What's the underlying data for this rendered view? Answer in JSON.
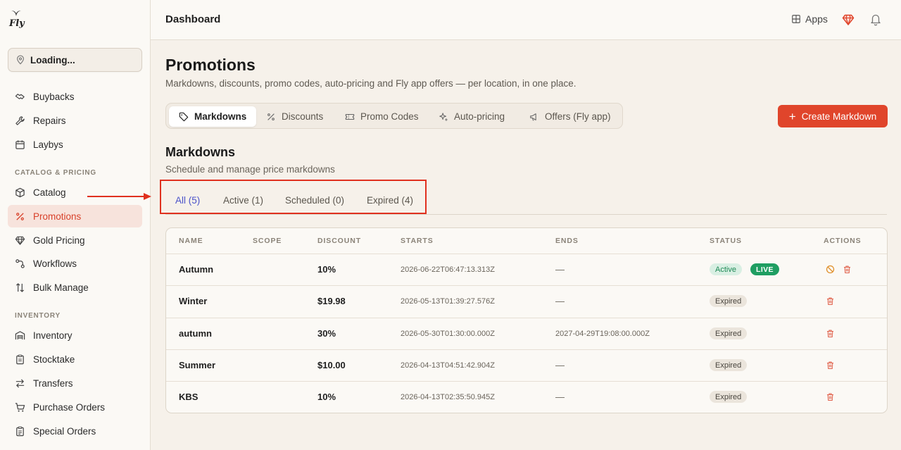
{
  "app": {
    "logo_text": "Fly"
  },
  "location": {
    "value": "Loading..."
  },
  "sidebar": {
    "top_items": [
      {
        "label": "Buybacks"
      },
      {
        "label": "Repairs"
      },
      {
        "label": "Laybys"
      }
    ],
    "sections": [
      {
        "title": "CATALOG & PRICING",
        "items": [
          {
            "label": "Catalog"
          },
          {
            "label": "Promotions"
          },
          {
            "label": "Gold Pricing"
          },
          {
            "label": "Workflows"
          },
          {
            "label": "Bulk Manage"
          }
        ]
      },
      {
        "title": "INVENTORY",
        "items": [
          {
            "label": "Inventory"
          },
          {
            "label": "Stocktake"
          },
          {
            "label": "Transfers"
          },
          {
            "label": "Purchase Orders"
          },
          {
            "label": "Special Orders"
          }
        ]
      }
    ]
  },
  "header": {
    "title": "Dashboard",
    "apps_label": "Apps"
  },
  "page": {
    "title": "Promotions",
    "subtitle": "Markdowns, discounts, promo codes, auto-pricing and Fly app offers — per location, in one place."
  },
  "tabs": [
    {
      "label": "Markdowns"
    },
    {
      "label": "Discounts"
    },
    {
      "label": "Promo Codes"
    },
    {
      "label": "Auto-pricing"
    },
    {
      "label": "Offers (Fly app)"
    }
  ],
  "create_button": {
    "label": "Create Markdown"
  },
  "section": {
    "title": "Markdowns",
    "subtitle": "Schedule and manage price markdowns"
  },
  "subtabs": [
    {
      "label": "All (5)"
    },
    {
      "label": "Active (1)"
    },
    {
      "label": "Scheduled (0)"
    },
    {
      "label": "Expired (4)"
    }
  ],
  "table": {
    "headers": [
      "NAME",
      "SCOPE",
      "DISCOUNT",
      "STARTS",
      "ENDS",
      "STATUS",
      "ACTIONS"
    ],
    "rows": [
      {
        "name": "Autumn",
        "scope": "",
        "discount": "10%",
        "starts": "2026-06-22T06:47:13.313Z",
        "ends": "—",
        "status": "Active",
        "live": "LIVE"
      },
      {
        "name": "Winter",
        "scope": "",
        "discount": "$19.98",
        "starts": "2026-05-13T01:39:27.576Z",
        "ends": "—",
        "status": "Expired"
      },
      {
        "name": "autumn",
        "scope": "",
        "discount": "30%",
        "starts": "2026-05-30T01:30:00.000Z",
        "ends": "2027-04-29T19:08:00.000Z",
        "status": "Expired"
      },
      {
        "name": "Summer",
        "scope": "",
        "discount": "$10.00",
        "starts": "2026-04-13T04:51:42.904Z",
        "ends": "—",
        "status": "Expired"
      },
      {
        "name": "KBS",
        "scope": "",
        "discount": "10%",
        "starts": "2026-04-13T02:35:50.945Z",
        "ends": "—",
        "status": "Expired"
      }
    ]
  },
  "colors": {
    "accent": "#e0452b",
    "active_tab": "#4b52c9",
    "annotation": "#e0311f"
  }
}
